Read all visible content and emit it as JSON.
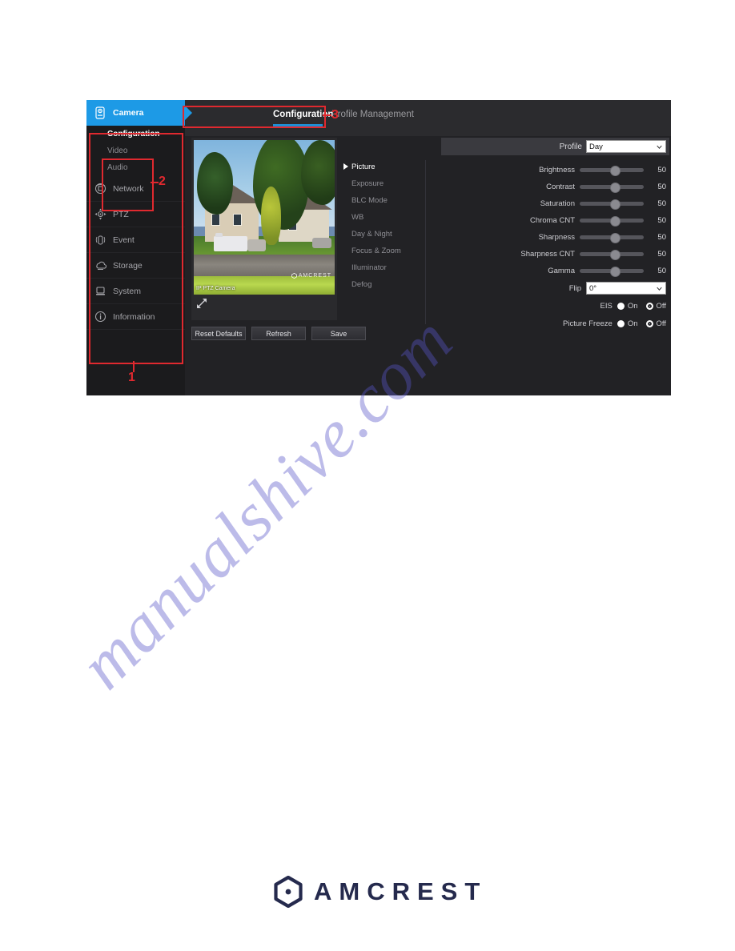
{
  "page": {
    "watermark_text": "manualshive.com",
    "footer_brand": "AMCREST"
  },
  "tabs": [
    {
      "label": "Configuration",
      "active": true
    },
    {
      "label": "Profile Management",
      "active": false
    }
  ],
  "sidebar": {
    "items": [
      {
        "label": "Camera",
        "icon": "camera-icon",
        "active": true
      },
      {
        "label": "Network",
        "icon": "network-icon",
        "active": false
      },
      {
        "label": "PTZ",
        "icon": "ptz-icon",
        "active": false
      },
      {
        "label": "Event",
        "icon": "event-icon",
        "active": false
      },
      {
        "label": "Storage",
        "icon": "storage-icon",
        "active": false
      },
      {
        "label": "System",
        "icon": "system-icon",
        "active": false
      },
      {
        "label": "Information",
        "icon": "information-icon",
        "active": false
      }
    ],
    "sub_items": [
      {
        "label": "Configuration",
        "active": true
      },
      {
        "label": "Video",
        "active": false
      },
      {
        "label": "Audio",
        "active": false
      }
    ]
  },
  "video": {
    "osd_text": "IP PTZ Camera",
    "brand_watermark": "AMCREST",
    "expand_icon": "expand-icon"
  },
  "submenu": [
    {
      "label": "Picture",
      "active": true
    },
    {
      "label": "Exposure",
      "active": false
    },
    {
      "label": "BLC Mode",
      "active": false
    },
    {
      "label": "WB",
      "active": false
    },
    {
      "label": "Day & Night",
      "active": false
    },
    {
      "label": "Focus & Zoom",
      "active": false
    },
    {
      "label": "Illuminator",
      "active": false
    },
    {
      "label": "Defog",
      "active": false
    }
  ],
  "settings": {
    "profile": {
      "label": "Profile",
      "value": "Day"
    },
    "sliders": [
      {
        "label": "Brightness",
        "value": "50"
      },
      {
        "label": "Contrast",
        "value": "50"
      },
      {
        "label": "Saturation",
        "value": "50"
      },
      {
        "label": "Chroma CNT",
        "value": "50"
      },
      {
        "label": "Sharpness",
        "value": "50"
      },
      {
        "label": "Sharpness CNT",
        "value": "50"
      },
      {
        "label": "Gamma",
        "value": "50"
      }
    ],
    "flip": {
      "label": "Flip",
      "value": "0°"
    },
    "eis": {
      "label": "EIS",
      "on_label": "On",
      "off_label": "Off",
      "selected": "Off"
    },
    "picture_freeze": {
      "label": "Picture Freeze",
      "on_label": "On",
      "off_label": "Off",
      "selected": "Off"
    }
  },
  "buttons": [
    {
      "label": "Reset Defaults"
    },
    {
      "label": "Refresh"
    },
    {
      "label": "Save"
    }
  ],
  "annotations": [
    {
      "number": "1"
    },
    {
      "number": "2"
    },
    {
      "number": "3"
    }
  ],
  "colors": {
    "accent_blue": "#1d9ae6",
    "annotation_red": "#e0292f",
    "panel_bg": "#222225",
    "sidebar_bg": "#1b1b1d",
    "logo_navy": "#252a4d"
  }
}
